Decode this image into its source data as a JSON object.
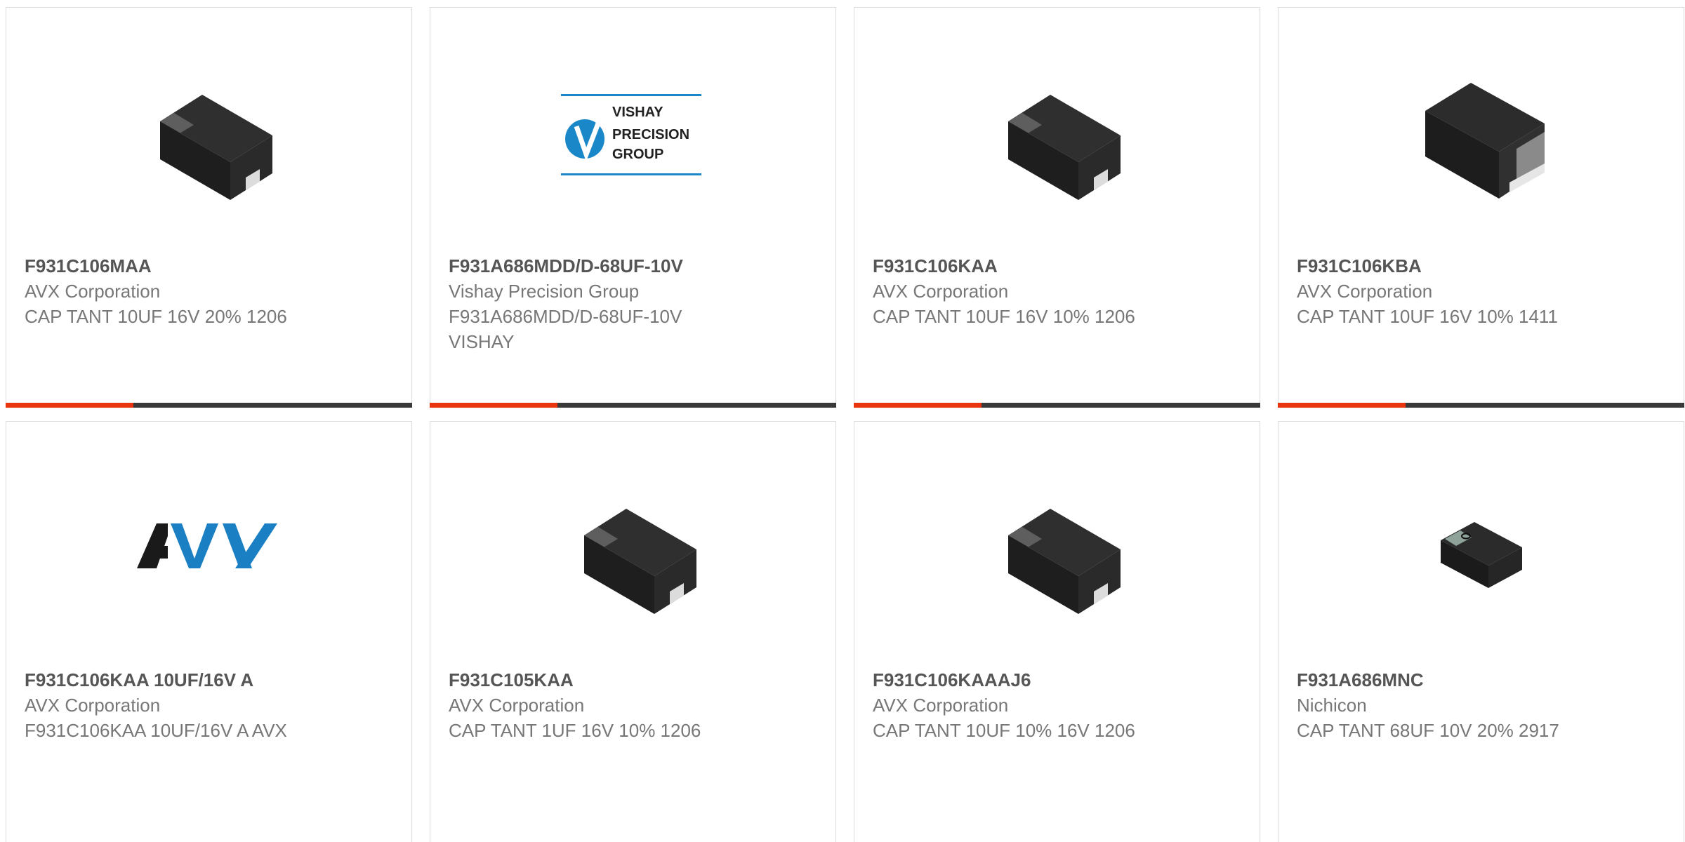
{
  "products": [
    {
      "part": "F931C106MAA",
      "manufacturer": "AVX Corporation",
      "desc": "CAP TANT 10UF 16V 20% 1206",
      "desc2": "",
      "image": "capacitor-a-icon"
    },
    {
      "part": "F931A686MDD/D-68UF-10V",
      "manufacturer": "Vishay Precision Group",
      "desc": "F931A686MDD/D-68UF-10V",
      "desc2": "VISHAY",
      "image": "vishay-logo",
      "logo_lines": [
        "VISHAY",
        "PRECISION",
        "GROUP"
      ]
    },
    {
      "part": "F931C106KAA",
      "manufacturer": "AVX Corporation",
      "desc": "CAP TANT 10UF 16V 10% 1206",
      "desc2": "",
      "image": "capacitor-a-icon"
    },
    {
      "part": "F931C106KBA",
      "manufacturer": "AVX Corporation",
      "desc": "CAP TANT 10UF 16V 10% 1411",
      "desc2": "",
      "image": "capacitor-b-icon"
    },
    {
      "part": "F931C106KAA 10UF/16V A",
      "manufacturer": "AVX Corporation",
      "desc": "F931C106KAA 10UF/16V A AVX",
      "desc2": "",
      "image": "avx-logo"
    },
    {
      "part": "F931C105KAA",
      "manufacturer": "AVX Corporation",
      "desc": "CAP TANT 1UF 16V 10% 1206",
      "desc2": "",
      "image": "capacitor-a-icon"
    },
    {
      "part": "F931C106KAAAJ6",
      "manufacturer": "AVX Corporation",
      "desc": "CAP TANT 10UF 10% 16V 1206",
      "desc2": "",
      "image": "capacitor-a-icon"
    },
    {
      "part": "F931A686MNC",
      "manufacturer": "Nichicon",
      "desc": "CAP TANT 68UF 10V 20% 2917",
      "desc2": "",
      "image": "capacitor-c-icon"
    }
  ],
  "colors": {
    "accent": "#e8340f",
    "bar": "#3a3a3a",
    "vishay_blue": "#1a87c9",
    "avx_blue": "#1b7fc4"
  }
}
